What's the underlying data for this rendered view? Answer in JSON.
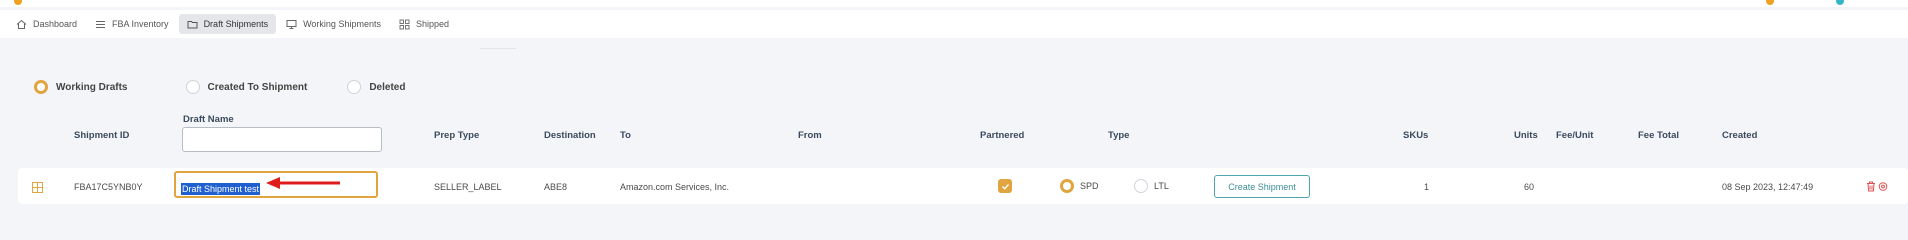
{
  "nav": {
    "items": [
      {
        "label": "Dashboard",
        "icon": "home-icon",
        "active": false
      },
      {
        "label": "FBA Inventory",
        "icon": "list-icon",
        "active": false
      },
      {
        "label": "Draft Shipments",
        "icon": "folder-icon",
        "active": true
      },
      {
        "label": "Working Shipments",
        "icon": "monitor-icon",
        "active": false
      },
      {
        "label": "Shipped",
        "icon": "grid-icon",
        "active": false
      }
    ]
  },
  "filters": {
    "options": [
      {
        "label": "Working Drafts",
        "selected": true
      },
      {
        "label": "Created To Shipment",
        "selected": false
      },
      {
        "label": "Deleted",
        "selected": false
      }
    ]
  },
  "table": {
    "headers": {
      "shipment_id": "Shipment ID",
      "draft_name": "Draft Name",
      "prep_type": "Prep Type",
      "destination": "Destination",
      "to": "To",
      "from": "From",
      "partnered": "Partnered",
      "type": "Type",
      "skus": "SKUs",
      "units": "Units",
      "fee_unit": "Fee/Unit",
      "fee_total": "Fee Total",
      "created": "Created"
    },
    "draft_name_filter_value": "",
    "rows": [
      {
        "shipment_id": "FBA17C5YNB0Y",
        "draft_name": "Draft Shipment test",
        "prep_type": "SELLER_LABEL",
        "destination": "ABE8",
        "to": "Amazon.com Services, Inc.",
        "from": "",
        "partnered": true,
        "type_options": [
          "SPD",
          "LTL"
        ],
        "type_selected": "SPD",
        "create_button": "Create Shipment",
        "skus": "1",
        "units": "60",
        "fee_unit": "",
        "fee_total": "",
        "created": "08 Sep 2023, 12:47:49"
      }
    ]
  },
  "colors": {
    "accent": "#e0a53f",
    "teal": "#4ea7b0",
    "selection": "#1f5fd0",
    "arrow": "#e01b1b",
    "delete": "#e05050"
  }
}
